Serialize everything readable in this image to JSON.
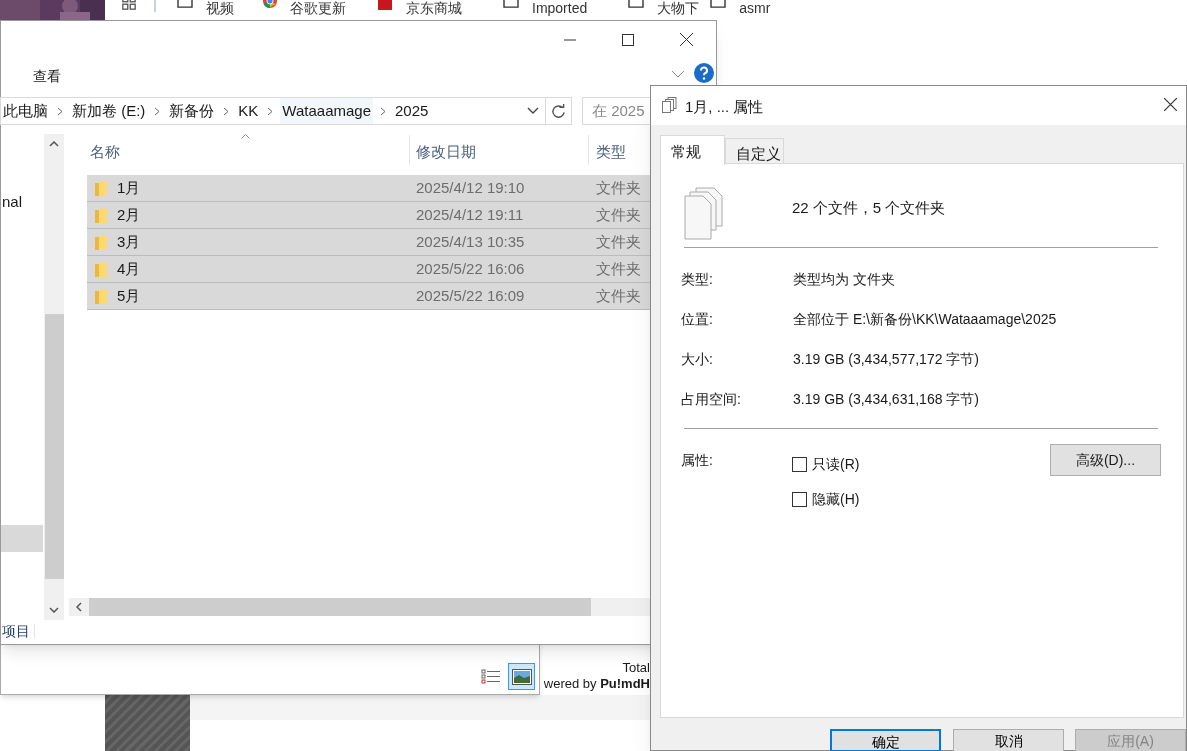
{
  "browser": {
    "bookmarks": [
      {
        "kind": "folder",
        "label": "视频"
      },
      {
        "kind": "chrome",
        "label": "谷歌更新"
      },
      {
        "kind": "jd",
        "label": "京东商城"
      },
      {
        "kind": "folder",
        "label": "Imported"
      },
      {
        "kind": "folder",
        "label": "大物下"
      },
      {
        "kind": "folder",
        "label": "asmr"
      }
    ],
    "page_texts": [
      "Total",
      "wered by **Pu!mdH**"
    ]
  },
  "viewer": {
    "view_buttons": [
      {
        "kind": "details",
        "selected": false
      },
      {
        "kind": "preview",
        "selected": true
      }
    ]
  },
  "explorer": {
    "ribbon_tab": "查看",
    "breadcrumbs": [
      {
        "label": "此电脑",
        "selected": false
      },
      {
        "label": "新加卷 (E:)",
        "selected": false
      },
      {
        "label": "新备份",
        "selected": false
      },
      {
        "label": "KK",
        "selected": false
      },
      {
        "label": "Wataaamage",
        "selected": true
      },
      {
        "label": "2025",
        "selected": false
      }
    ],
    "search": {
      "placeholder": "在 2025"
    },
    "nav_pane": {
      "items": [
        {
          "label": "nal"
        }
      ]
    },
    "columns": [
      "名称",
      "修改日期",
      "类型"
    ],
    "rows": [
      {
        "name": "1月",
        "modified": "2025/4/12 19:10",
        "type": "文件夹",
        "selected": true
      },
      {
        "name": "2月",
        "modified": "2025/4/12 19:11",
        "type": "文件夹",
        "selected": true
      },
      {
        "name": "3月",
        "modified": "2025/4/13 10:35",
        "type": "文件夹",
        "selected": true
      },
      {
        "name": "4月",
        "modified": "2025/5/22 16:06",
        "type": "文件夹",
        "selected": true
      },
      {
        "name": "5月",
        "modified": "2025/5/22 16:09",
        "type": "文件夹",
        "selected": true
      }
    ],
    "status_bar": "项目"
  },
  "dialog": {
    "title": "1月, ... 属性",
    "tabs": [
      {
        "label": "常规",
        "selected": true
      },
      {
        "label": "自定义",
        "selected": false
      }
    ],
    "summary": "22 个文件，5 个文件夹",
    "properties": [
      {
        "label": "类型:",
        "value": "类型均为 文件夹"
      },
      {
        "label": "位置:",
        "value": "全部位于 E:\\新备份\\KK\\Wataaamage\\2025"
      },
      {
        "label": "大小:",
        "value": "3.19 GB (3,434,577,172 字节)"
      },
      {
        "label": "占用空间:",
        "value": "3.19 GB (3,434,631,168 字节)"
      }
    ],
    "attributes_label": "属性:",
    "attributes": [
      {
        "label": "只读(R)",
        "checked": false
      },
      {
        "label": "隐藏(H)",
        "checked": false
      }
    ],
    "advanced_button": "高级(D)...",
    "buttons": [
      {
        "label": "确定",
        "default": true,
        "disabled": false
      },
      {
        "label": "取消",
        "default": false,
        "disabled": false
      },
      {
        "label": "应用(A)",
        "default": false,
        "disabled": true
      }
    ]
  }
}
